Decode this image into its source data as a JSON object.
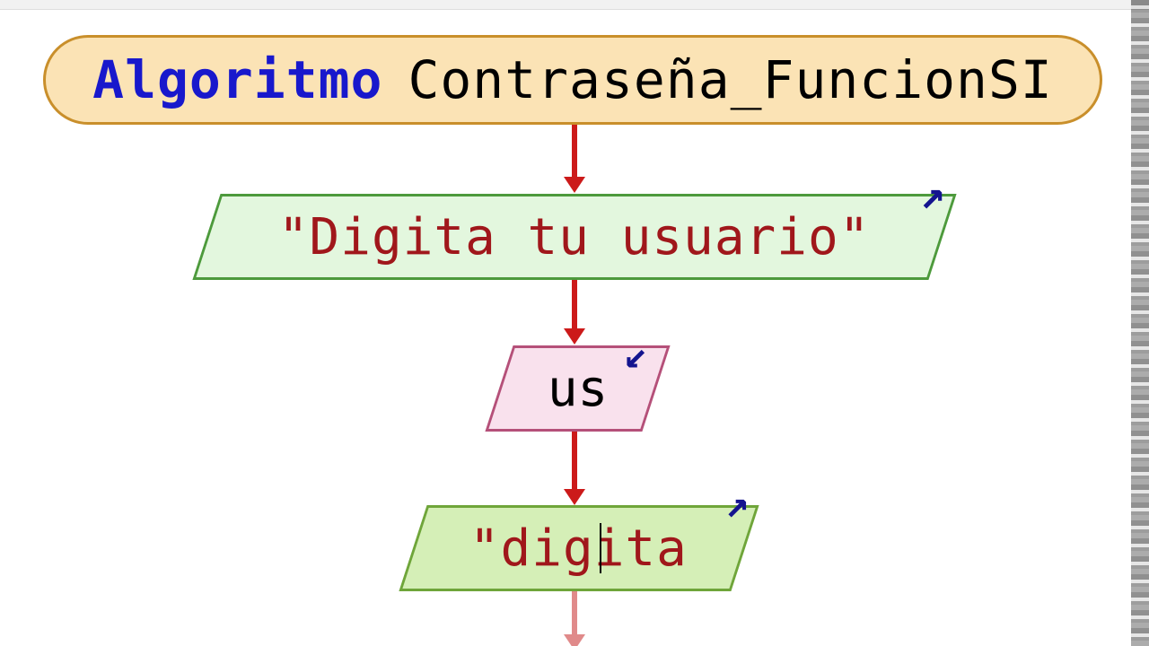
{
  "header": {
    "keyword": "Algoritmo",
    "name": "Contraseña_FuncionSI"
  },
  "blocks": {
    "output1": "\"Digita tu usuario\"",
    "input1": "us",
    "output2": "\"digita"
  },
  "icons": {
    "io_out": "↗",
    "io_in": "↙"
  },
  "chart_data": {
    "type": "flowchart",
    "nodes": [
      {
        "id": "start",
        "kind": "terminator",
        "label": "Algoritmo Contraseña_FuncionSI"
      },
      {
        "id": "out1",
        "kind": "output",
        "label": "\"Digita tu usuario\""
      },
      {
        "id": "in1",
        "kind": "input",
        "label": "us"
      },
      {
        "id": "out2",
        "kind": "output",
        "label": "\"digita"
      }
    ],
    "edges": [
      {
        "from": "start",
        "to": "out1"
      },
      {
        "from": "out1",
        "to": "in1"
      },
      {
        "from": "in1",
        "to": "out2"
      }
    ]
  }
}
